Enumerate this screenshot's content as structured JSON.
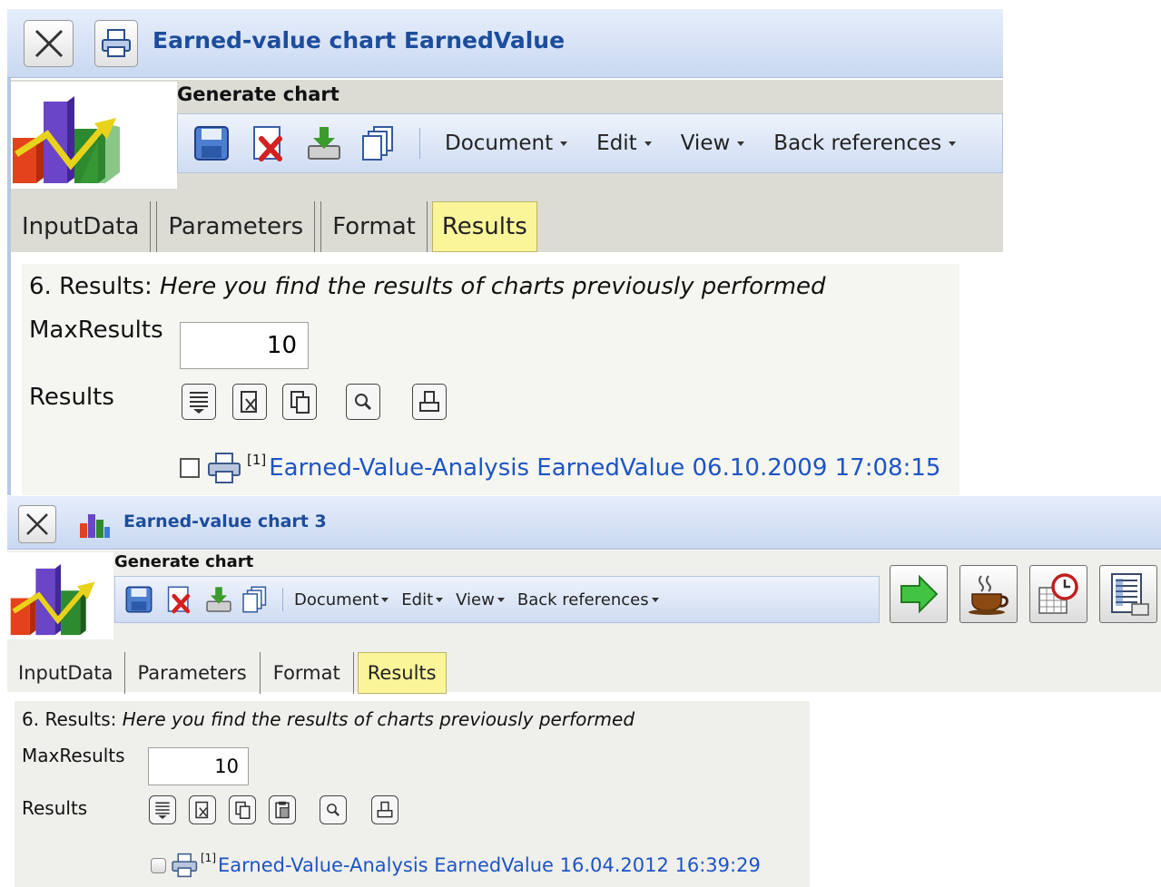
{
  "window_top": {
    "title": "Earned-value chart EarnedValue",
    "header_label": "Generate chart",
    "menus": [
      "Document",
      "Edit",
      "View",
      "Back references"
    ],
    "tabs": [
      {
        "label": "InputData",
        "active": false
      },
      {
        "label": "Parameters",
        "active": false
      },
      {
        "label": "Format",
        "active": false
      },
      {
        "label": "Results",
        "active": true
      }
    ],
    "results": {
      "heading_prefix": "6. Results:",
      "heading_italic": "Here you find the results of charts previously performed",
      "max_results_label": "MaxResults",
      "max_results_value": "10",
      "results_label": "Results",
      "entry_marker": "[1]",
      "entry_link": "Earned-Value-Analysis EarnedValue 06.10.2009 17:08:15"
    }
  },
  "window_bottom": {
    "title": "Earned-value chart 3",
    "header_label": "Generate chart",
    "menus": [
      "Document",
      "Edit",
      "View",
      "Back references"
    ],
    "tabs": [
      {
        "label": "InputData",
        "active": false
      },
      {
        "label": "Parameters",
        "active": false
      },
      {
        "label": "Format",
        "active": false
      },
      {
        "label": "Results",
        "active": true
      }
    ],
    "results": {
      "heading_prefix": "6. Results:",
      "heading_italic": "Here you find the results of charts previously performed",
      "max_results_label": "MaxResults",
      "max_results_value": "10",
      "results_label": "Results",
      "entry_marker": "[1]",
      "entry_link": "Earned-Value-Analysis EarnedValue 16.04.2012 16:39:29"
    },
    "action_buttons": [
      "run-arrow-icon",
      "coffee-cup-icon",
      "schedule-clock-icon",
      "report-table-icon"
    ]
  },
  "colors": {
    "title_text": "#1d4d9c",
    "active_tab": "#fbf59a",
    "link": "#1e55c5",
    "panel_bg": "#f6f6f1"
  }
}
